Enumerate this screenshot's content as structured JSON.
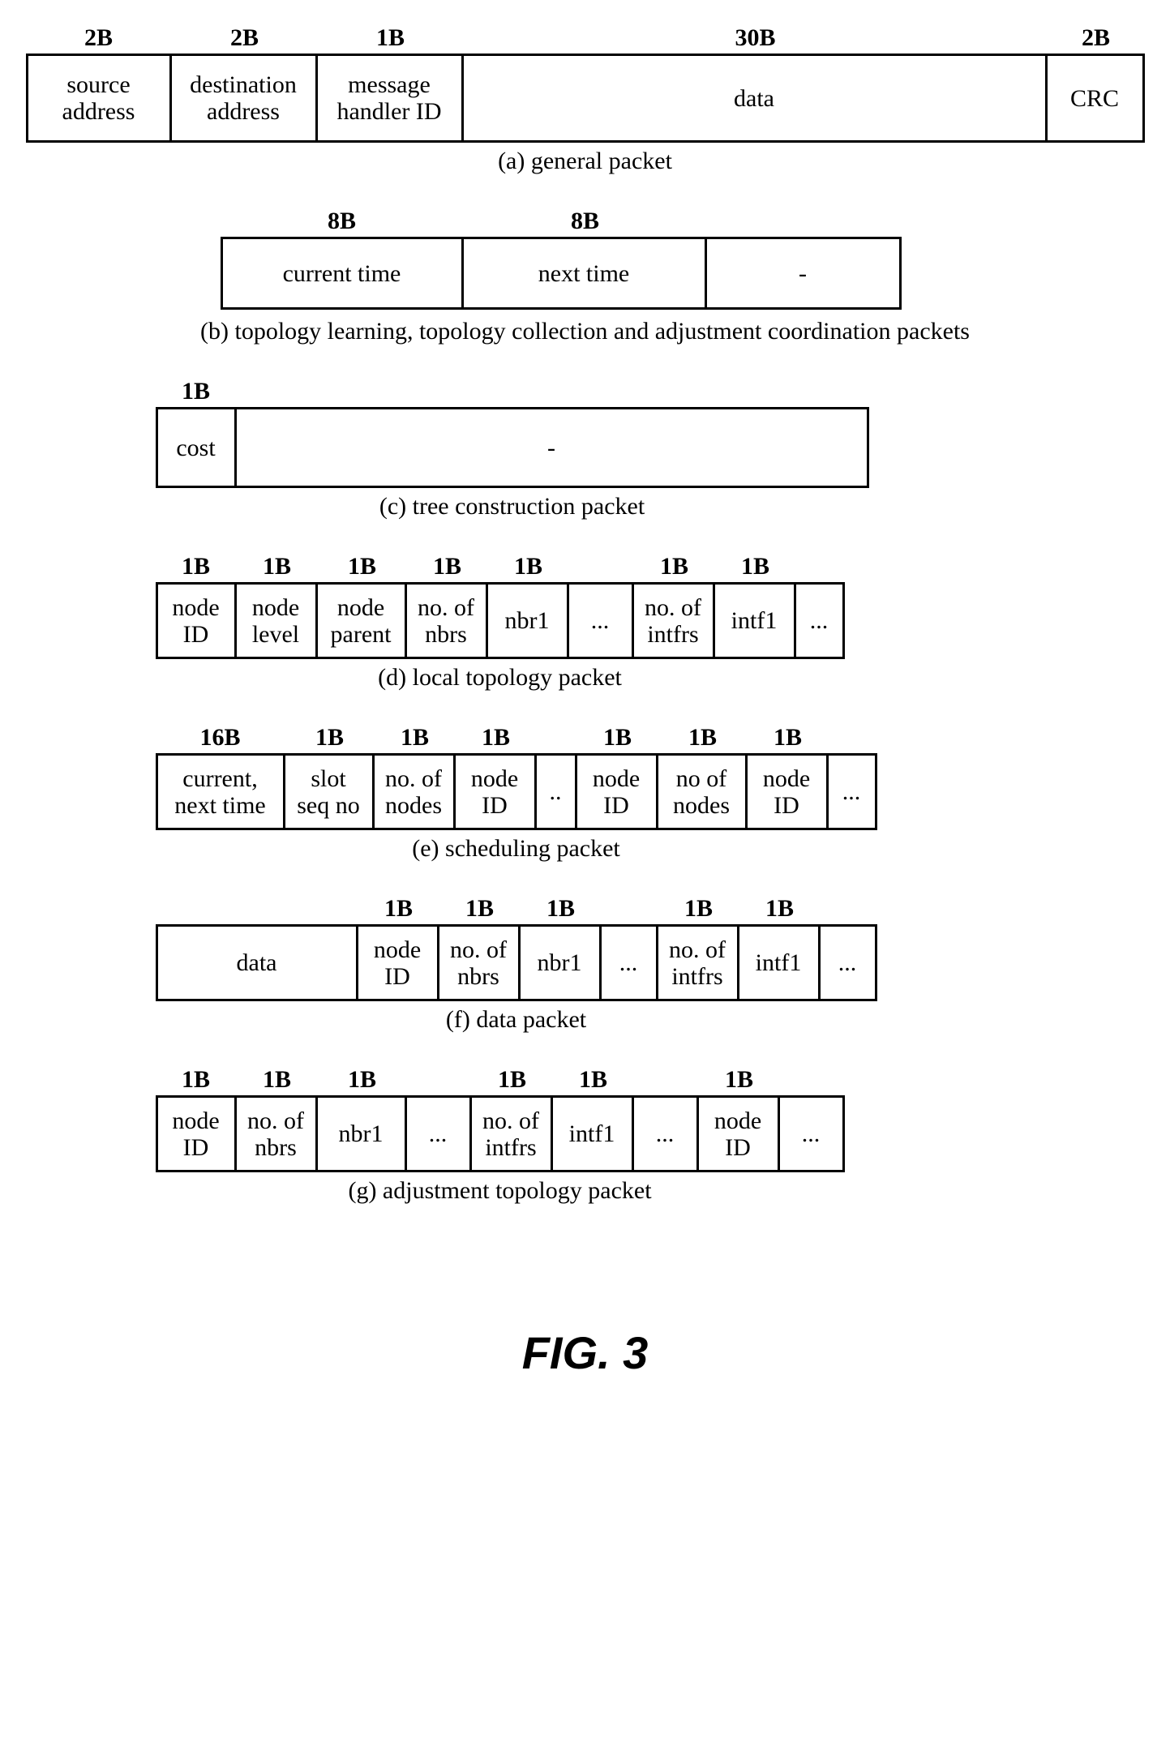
{
  "figure_title": "FIG. 3",
  "a": {
    "sizes": [
      "2B",
      "2B",
      "1B",
      "30B",
      "2B"
    ],
    "cells": [
      "source\naddress",
      "destination\naddress",
      "message\nhandler ID",
      "data",
      "CRC"
    ],
    "caption": "(a) general packet"
  },
  "b": {
    "sizes": [
      "8B",
      "8B"
    ],
    "cells": [
      "current time",
      "next time",
      "-"
    ],
    "caption": "(b) topology learning, topology collection and adjustment coordination packets"
  },
  "c": {
    "sizes": [
      "1B"
    ],
    "cells": [
      "cost",
      "-"
    ],
    "caption": "(c) tree construction packet"
  },
  "d": {
    "sizes": [
      "1B",
      "1B",
      "1B",
      "1B",
      "1B",
      "",
      "1B",
      "1B"
    ],
    "cells": [
      "node\nID",
      "node\nlevel",
      "node\nparent",
      "no. of\nnbrs",
      "nbr1",
      "...",
      "no. of\nintfrs",
      "intf1",
      "..."
    ],
    "caption": "(d) local topology packet"
  },
  "e": {
    "sizes": [
      "16B",
      "1B",
      "1B",
      "1B",
      "",
      "1B",
      "1B",
      "1B"
    ],
    "cells": [
      "current,\nnext time",
      "slot\nseq no",
      "no. of\nnodes",
      "node\nID",
      "..",
      "node\nID",
      "no of\nnodes",
      "node\nID",
      "..."
    ],
    "caption": "(e) scheduling packet"
  },
  "f": {
    "sizes": [
      "",
      "1B",
      "1B",
      "1B",
      "",
      "1B",
      "1B"
    ],
    "cells": [
      "data",
      "node\nID",
      "no. of\nnbrs",
      "nbr1",
      "...",
      "no. of\nintfrs",
      "intf1",
      "..."
    ],
    "caption": "(f) data packet"
  },
  "g": {
    "sizes": [
      "1B",
      "1B",
      "1B",
      "",
      "1B",
      "1B",
      "",
      "1B"
    ],
    "cells": [
      "node\nID",
      "no. of\nnbrs",
      "nbr1",
      "...",
      "no. of\nintfrs",
      "intf1",
      "...",
      "node\nID",
      "..."
    ],
    "caption": "(g) adjustment topology packet"
  }
}
